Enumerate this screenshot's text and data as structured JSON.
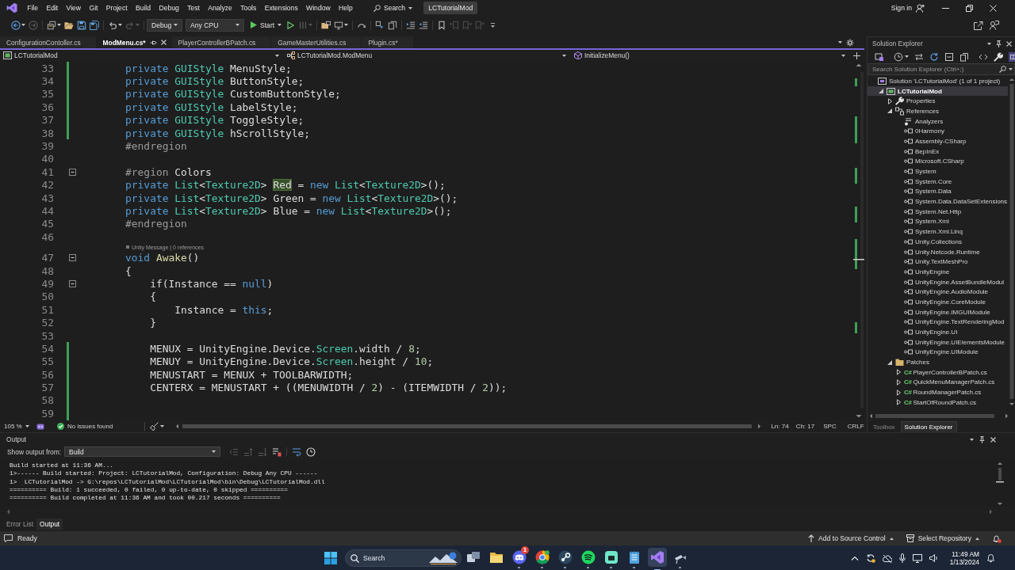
{
  "menu_bar": {
    "items": [
      "File",
      "Edit",
      "View",
      "Git",
      "Project",
      "Build",
      "Debug",
      "Test",
      "Analyze",
      "Tools",
      "Extensions",
      "Window",
      "Help"
    ],
    "search": "Search",
    "solution_name": "LCTutorialMod",
    "sign_in": "Sign in"
  },
  "toolbar": {
    "left_buttons": [
      {
        "disabled": false
      },
      {
        "disabled": true
      },
      {
        "disabled": false
      },
      {
        "disabled": false
      },
      {
        "disabled": false
      },
      {
        "disabled": false
      },
      {
        "disabled": false
      },
      {
        "disabled": true
      }
    ],
    "configuration": "Debug",
    "platform": "Any CPU",
    "start": "Start",
    "right_buttons": [
      {
        "disabled": false
      },
      {
        "disabled": true
      },
      {
        "disabled": false
      },
      {
        "disabled": false
      },
      {
        "disabled": false
      },
      {
        "disabled": false
      },
      {
        "disabled": false
      },
      {
        "disabled": false
      },
      {
        "disabled": false
      },
      {
        "disabled": false
      },
      {
        "disabled": true
      },
      {
        "disabled": true
      },
      {
        "disabled": true
      }
    ]
  },
  "document_tabs": [
    {
      "label": "ConfigurationContoller.cs",
      "selected": false
    },
    {
      "label": "ModMenu.cs*",
      "selected": true
    },
    {
      "label": "PlayerControllerBPatch.cs",
      "selected": false
    },
    {
      "label": "GameMasterUtilities.cs",
      "selected": false
    },
    {
      "label": "Plugin.cs*",
      "selected": false
    }
  ],
  "navigation_bar": {
    "project": "LCTutorialMod",
    "type": "LCTutorialMod.ModMenu",
    "member": "InitializeMenu()"
  },
  "editor": {
    "lines": [
      {
        "number": "33",
        "kind": "code",
        "changed": true,
        "foldable": false,
        "tokens": [
          {
            "kind": "keyword",
            "text": "        private"
          },
          {
            "kind": "type",
            "text": " GUIStyle"
          },
          {
            "kind": "plain",
            "text": " MenuStyle;"
          }
        ]
      },
      {
        "number": "34",
        "kind": "code",
        "changed": true,
        "foldable": false,
        "tokens": [
          {
            "kind": "keyword",
            "text": "        private"
          },
          {
            "kind": "type",
            "text": " GUIStyle"
          },
          {
            "kind": "plain",
            "text": " ButtonStyle;"
          }
        ]
      },
      {
        "number": "35",
        "kind": "code",
        "changed": true,
        "foldable": false,
        "tokens": [
          {
            "kind": "keyword",
            "text": "        private"
          },
          {
            "kind": "type",
            "text": " GUIStyle"
          },
          {
            "kind": "plain",
            "text": " CustomButtonStyle;"
          }
        ]
      },
      {
        "number": "36",
        "kind": "code",
        "changed": true,
        "foldable": false,
        "tokens": [
          {
            "kind": "keyword",
            "text": "        private"
          },
          {
            "kind": "type",
            "text": " GUIStyle"
          },
          {
            "kind": "plain",
            "text": " LabelStyle;"
          }
        ]
      },
      {
        "number": "37",
        "kind": "code",
        "changed": true,
        "foldable": false,
        "tokens": [
          {
            "kind": "keyword",
            "text": "        private"
          },
          {
            "kind": "type",
            "text": " GUIStyle"
          },
          {
            "kind": "plain",
            "text": " ToggleStyle;"
          }
        ]
      },
      {
        "number": "38",
        "kind": "code",
        "changed": true,
        "foldable": false,
        "tokens": [
          {
            "kind": "keyword",
            "text": "        private"
          },
          {
            "kind": "type",
            "text": " GUIStyle"
          },
          {
            "kind": "plain",
            "text": " hScrollStyle;"
          }
        ]
      },
      {
        "number": "39",
        "kind": "code",
        "changed": false,
        "foldable": false,
        "tokens": [
          {
            "kind": "preprocessor",
            "text": "        #endregion"
          }
        ]
      },
      {
        "number": "40",
        "kind": "code",
        "changed": false,
        "foldable": false
      },
      {
        "number": "41",
        "kind": "code",
        "changed": false,
        "foldable": true,
        "tokens": [
          {
            "kind": "preprocessor",
            "text": "        #region"
          },
          {
            "kind": "plain",
            "text": " Colors"
          }
        ]
      },
      {
        "number": "42",
        "kind": "code",
        "changed": false,
        "foldable": false,
        "tokens": [
          {
            "kind": "keyword",
            "text": "        private"
          },
          {
            "kind": "type",
            "text": " List"
          },
          {
            "kind": "plain",
            "text": "<"
          },
          {
            "kind": "type",
            "text": "Texture2D"
          },
          {
            "kind": "plain",
            "text": "> "
          },
          {
            "kind": "reference_highlight",
            "text": "Red"
          },
          {
            "kind": "plain",
            "text": " = "
          },
          {
            "kind": "keyword",
            "text": "new"
          },
          {
            "kind": "type",
            "text": " List"
          },
          {
            "kind": "plain",
            "text": "<"
          },
          {
            "kind": "type",
            "text": "Texture2D"
          },
          {
            "kind": "plain",
            "text": ">();"
          }
        ]
      },
      {
        "number": "43",
        "kind": "code",
        "changed": false,
        "foldable": false,
        "tokens": [
          {
            "kind": "keyword",
            "text": "        private"
          },
          {
            "kind": "type",
            "text": " List"
          },
          {
            "kind": "plain",
            "text": "<"
          },
          {
            "kind": "type",
            "text": "Texture2D"
          },
          {
            "kind": "plain",
            "text": "> Green = "
          },
          {
            "kind": "keyword",
            "text": "new"
          },
          {
            "kind": "type",
            "text": " List"
          },
          {
            "kind": "plain",
            "text": "<"
          },
          {
            "kind": "type",
            "text": "Texture2D"
          },
          {
            "kind": "plain",
            "text": ">();"
          }
        ]
      },
      {
        "number": "44",
        "kind": "code",
        "changed": false,
        "foldable": false,
        "tokens": [
          {
            "kind": "keyword",
            "text": "        private"
          },
          {
            "kind": "type",
            "text": " List"
          },
          {
            "kind": "plain",
            "text": "<"
          },
          {
            "kind": "type",
            "text": "Texture2D"
          },
          {
            "kind": "plain",
            "text": "> Blue = "
          },
          {
            "kind": "keyword",
            "text": "new"
          },
          {
            "kind": "type",
            "text": " List"
          },
          {
            "kind": "plain",
            "text": "<"
          },
          {
            "kind": "type",
            "text": "Texture2D"
          },
          {
            "kind": "plain",
            "text": ">();"
          }
        ]
      },
      {
        "number": "45",
        "kind": "code",
        "changed": false,
        "foldable": false,
        "tokens": [
          {
            "kind": "preprocessor",
            "text": "        #endregion"
          }
        ]
      },
      {
        "number": "46",
        "kind": "code",
        "changed": false,
        "foldable": false
      },
      {
        "kind": "codelens",
        "text": "Unity Message | 0 references"
      },
      {
        "number": "47",
        "kind": "code",
        "changed": false,
        "foldable": true,
        "tokens": [
          {
            "kind": "keyword",
            "text": "        void"
          },
          {
            "kind": "method",
            "text": " Awake"
          },
          {
            "kind": "plain",
            "text": "()"
          }
        ]
      },
      {
        "number": "48",
        "kind": "code",
        "changed": false,
        "foldable": false,
        "tokens": [
          {
            "kind": "plain",
            "text": "        {"
          }
        ]
      },
      {
        "number": "49",
        "kind": "code",
        "changed": false,
        "foldable": true,
        "tokens": [
          {
            "kind": "plain",
            "text": "            if(Instance == "
          },
          {
            "kind": "keyword",
            "text": "null"
          },
          {
            "kind": "plain",
            "text": ")"
          }
        ]
      },
      {
        "number": "50",
        "kind": "code",
        "changed": false,
        "foldable": false,
        "tokens": [
          {
            "kind": "plain",
            "text": "            {"
          }
        ]
      },
      {
        "number": "51",
        "kind": "code",
        "changed": false,
        "foldable": false,
        "tokens": [
          {
            "kind": "plain",
            "text": "                Instance = "
          },
          {
            "kind": "keyword",
            "text": "this"
          },
          {
            "kind": "plain",
            "text": ";"
          }
        ]
      },
      {
        "number": "52",
        "kind": "code",
        "changed": false,
        "foldable": false,
        "tokens": [
          {
            "kind": "plain",
            "text": "            }"
          }
        ]
      },
      {
        "number": "53",
        "kind": "code",
        "changed": false,
        "foldable": false
      },
      {
        "number": "54",
        "kind": "code",
        "changed": true,
        "foldable": false,
        "tokens": [
          {
            "kind": "plain",
            "text": "            MENUX = UnityEngine.Device."
          },
          {
            "kind": "type",
            "text": "Screen"
          },
          {
            "kind": "plain",
            "text": ".width / "
          },
          {
            "kind": "number",
            "text": "8"
          },
          {
            "kind": "plain",
            "text": ";"
          }
        ]
      },
      {
        "number": "55",
        "kind": "code",
        "changed": true,
        "foldable": false,
        "tokens": [
          {
            "kind": "plain",
            "text": "            MENUY = UnityEngine.Device."
          },
          {
            "kind": "type",
            "text": "Screen"
          },
          {
            "kind": "plain",
            "text": ".height / "
          },
          {
            "kind": "number",
            "text": "10"
          },
          {
            "kind": "plain",
            "text": ";"
          }
        ]
      },
      {
        "number": "56",
        "kind": "code",
        "changed": true,
        "foldable": false,
        "tokens": [
          {
            "kind": "plain",
            "text": "            MENUSTART = MENUX + TOOLBARWIDTH;"
          }
        ]
      },
      {
        "number": "57",
        "kind": "code",
        "changed": true,
        "foldable": false,
        "tokens": [
          {
            "kind": "plain",
            "text": "            CENTERX = MENUSTART + ((MENUWIDTH / "
          },
          {
            "kind": "number",
            "text": "2"
          },
          {
            "kind": "plain",
            "text": ") - (ITEMWIDTH / "
          },
          {
            "kind": "number",
            "text": "2"
          },
          {
            "kind": "plain",
            "text": "));"
          }
        ]
      },
      {
        "number": "58",
        "kind": "code",
        "changed": true,
        "foldable": false
      },
      {
        "number": "59",
        "kind": "code",
        "changed": true,
        "foldable": false
      }
    ]
  },
  "editor_status": {
    "zoom": "105 %",
    "issues": "No issues found",
    "line": "Ln: 74",
    "column": "Ch: 17",
    "whitespace": "SPC",
    "line_endings": "CRLF"
  },
  "solution_explorer": {
    "title": "Solution Explorer",
    "toolbar_buttons": [
      {
        "on": false
      },
      {
        "on": false
      },
      {
        "on": false
      },
      {
        "on": false
      },
      {
        "on": false
      },
      {
        "on": false
      },
      {
        "on": false
      },
      {
        "on": false
      },
      {
        "on": true
      }
    ],
    "search": {
      "placeholder": "Search Solution Explorer (Ctrl+;)"
    },
    "tree": [
      {
        "label": "Solution 'LCTutorialMod' (1 of 1 project)",
        "kind": "solution",
        "selected": false,
        "children": [
          {
            "label": "LCTutorialMod",
            "kind": "project",
            "selected": true,
            "expanded": true,
            "children": [
              {
                "label": "Properties",
                "kind": "properties",
                "selected": false,
                "expanded": false
              },
              {
                "label": "References",
                "kind": "references",
                "selected": false,
                "expanded": true,
                "children": [
                  {
                    "label": "Analyzers",
                    "kind": "analyzers",
                    "selected": false
                  },
                  {
                    "label": "0Harmony",
                    "kind": "reference",
                    "selected": false
                  },
                  {
                    "label": "Assembly-CSharp",
                    "kind": "reference",
                    "selected": false
                  },
                  {
                    "label": "BepInEx",
                    "kind": "reference",
                    "selected": false
                  },
                  {
                    "label": "Microsoft.CSharp",
                    "kind": "reference",
                    "selected": false
                  },
                  {
                    "label": "System",
                    "kind": "reference",
                    "selected": false
                  },
                  {
                    "label": "System.Core",
                    "kind": "reference",
                    "selected": false
                  },
                  {
                    "label": "System.Data",
                    "kind": "reference",
                    "selected": false
                  },
                  {
                    "label": "System.Data.DataSetExtensions",
                    "kind": "reference",
                    "selected": false
                  },
                  {
                    "label": "System.Net.Http",
                    "kind": "reference",
                    "selected": false
                  },
                  {
                    "label": "System.Xml",
                    "kind": "reference",
                    "selected": false
                  },
                  {
                    "label": "System.Xml.Linq",
                    "kind": "reference",
                    "selected": false
                  },
                  {
                    "label": "Unity.Collections",
                    "kind": "reference",
                    "selected": false
                  },
                  {
                    "label": "Unity.Netcode.Runtime",
                    "kind": "reference",
                    "selected": false
                  },
                  {
                    "label": "Unity.TextMeshPro",
                    "kind": "reference",
                    "selected": false
                  },
                  {
                    "label": "UnityEngine",
                    "kind": "reference",
                    "selected": false
                  },
                  {
                    "label": "UnityEngine.AssetBundleModul",
                    "kind": "reference",
                    "selected": false
                  },
                  {
                    "label": "UnityEngine.AudioModule",
                    "kind": "reference",
                    "selected": false
                  },
                  {
                    "label": "UnityEngine.CoreModule",
                    "kind": "reference",
                    "selected": false
                  },
                  {
                    "label": "UnityEngine.IMGUIModule",
                    "kind": "reference",
                    "selected": false
                  },
                  {
                    "label": "UnityEngine.TextRenderingMod",
                    "kind": "reference",
                    "selected": false
                  },
                  {
                    "label": "UnityEngine.UI",
                    "kind": "reference",
                    "selected": false
                  },
                  {
                    "label": "UnityEngine.UIElementsModule",
                    "kind": "reference",
                    "selected": false
                  },
                  {
                    "label": "UnityEngine.UIModule",
                    "kind": "reference",
                    "selected": false
                  }
                ]
              },
              {
                "label": "Patches",
                "kind": "folder",
                "selected": false,
                "expanded": true,
                "children": [
                  {
                    "label": "PlayerControllerBPatch.cs",
                    "kind": "file",
                    "icon_text": "C#",
                    "selected": false,
                    "expanded": false
                  },
                  {
                    "label": "QuickMenuManagerPatch.cs",
                    "kind": "file",
                    "icon_text": "C#",
                    "selected": false,
                    "expanded": false
                  },
                  {
                    "label": "RoundManagerPatch.cs",
                    "kind": "file",
                    "icon_text": "C#",
                    "selected": false,
                    "expanded": false
                  },
                  {
                    "label": "StartOfRoundPatch.cs",
                    "kind": "file",
                    "icon_text": "C#",
                    "selected": false,
                    "expanded": false
                  }
                ]
              }
            ]
          }
        ]
      }
    ],
    "tabs": [
      {
        "label": "Toolbox",
        "selected": false
      },
      {
        "label": "Solution Explorer",
        "selected": true
      }
    ]
  },
  "output": {
    "title": "Output",
    "source_label": "Show output from:",
    "source": "Build",
    "toolbar_buttons": [
      {
        "disabled": true
      },
      {
        "disabled": true
      },
      {
        "disabled": true
      },
      {
        "disabled": false
      },
      {
        "disabled": false
      },
      {
        "disabled": false
      }
    ],
    "lines": [
      "Build started at 11:36 AM...",
      "1>------ Build started: Project: LCTutorialMod, Configuration: Debug Any CPU ------",
      "1>  LCTutorialMod -> G:\\repos\\LCTutorialMod\\LCTutorialMod\\bin\\Debug\\LCTutorialMod.dll",
      "========== Build: 1 succeeded, 0 failed, 0 up-to-date, 0 skipped ==========",
      "========== Build completed at 11:36 AM and took 00.217 seconds =========="
    ]
  },
  "bottom_tabs": [
    {
      "label": "Error List",
      "selected": false
    },
    {
      "label": "Output",
      "selected": true
    }
  ],
  "status_bar": {
    "state": "Ready",
    "source_control": "Add to Source Control",
    "repository": "Select Repository"
  },
  "taskbar": {
    "search": "Search",
    "apps": [
      {
        "running": false,
        "active": false
      },
      {
        "running": false,
        "active": false
      },
      {
        "running": true,
        "active": false,
        "badge": "1"
      },
      {
        "running": true,
        "active": false
      },
      {
        "running": true,
        "active": false
      },
      {
        "running": true,
        "active": false
      },
      {
        "running": true,
        "active": false
      },
      {
        "running": true,
        "active": false
      },
      {
        "running": true,
        "active": true
      },
      {
        "running": true,
        "active": false
      }
    ],
    "time": "11:49 AM",
    "date": "1/13/2024"
  }
}
